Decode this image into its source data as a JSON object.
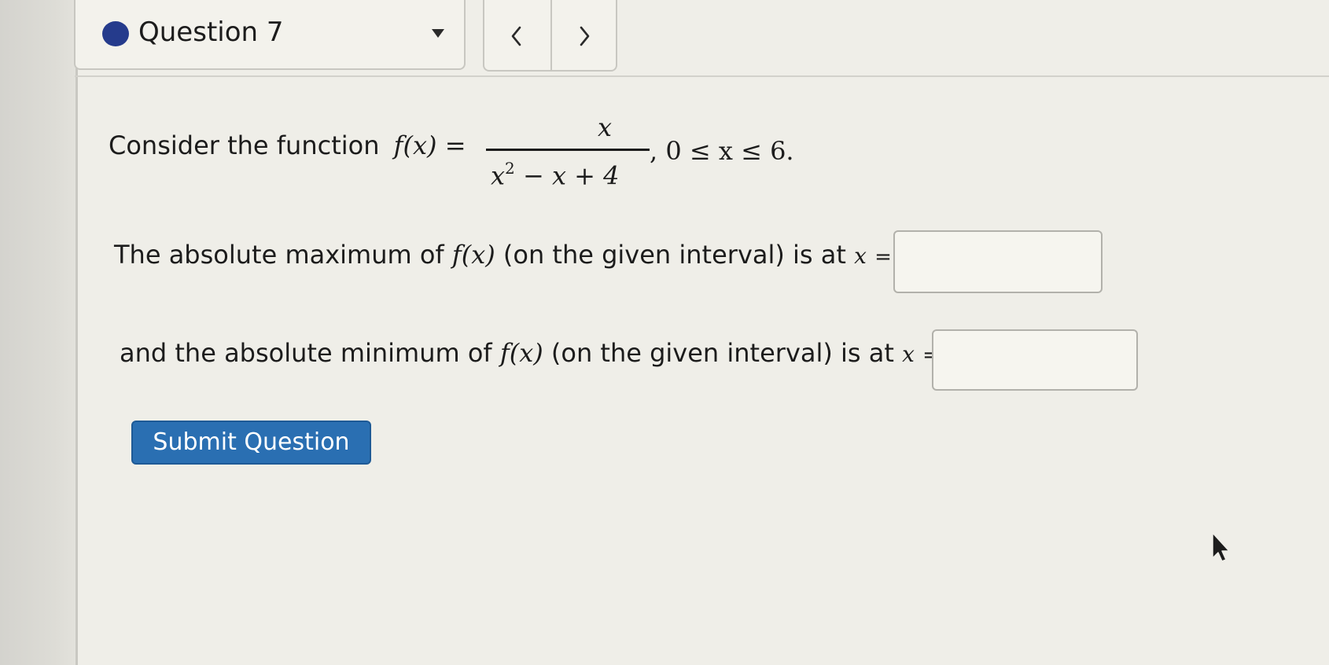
{
  "header": {
    "question_label": "Question 7",
    "status_color": "#253b8c",
    "prev_icon": "chevron-left-icon",
    "next_icon": "chevron-right-icon"
  },
  "question": {
    "intro": "Consider the function",
    "function_name": "f(x) =",
    "numerator": "x",
    "denominator_base": "x",
    "denominator_exponent": "2",
    "denominator_rest": " − x + 4",
    "domain": ",  0 ≤ x ≤ 6.",
    "max_prefix": "The absolute maximum of",
    "max_mid": "(on the given interval) is at",
    "min_prefix": "and the absolute minimum of",
    "min_mid": "(on the given interval) is at",
    "fx": "f(x)",
    "x_var": "x",
    "equals": "="
  },
  "answers": {
    "max_value": "",
    "min_value": ""
  },
  "actions": {
    "submit_label": "Submit Question",
    "accent_color": "#2a6fb2"
  }
}
